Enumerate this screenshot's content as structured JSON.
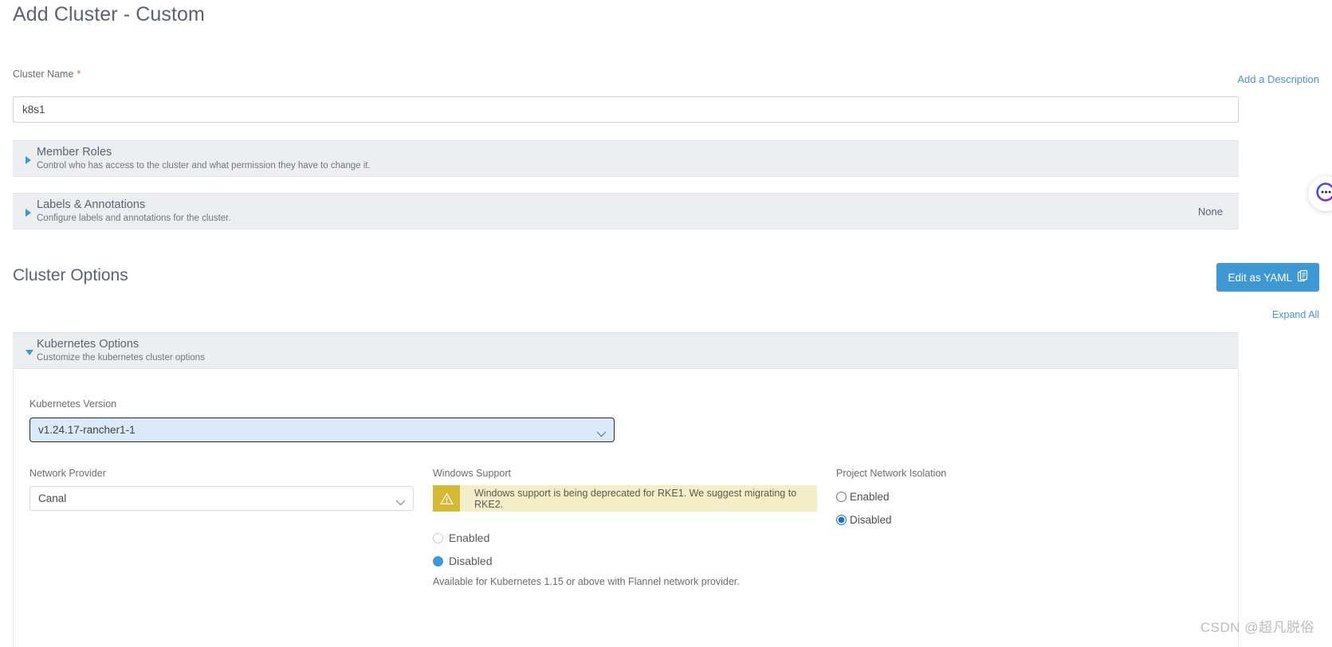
{
  "page": {
    "title": "Add Cluster - Custom",
    "watermark": "CSDN @超凡脱俗"
  },
  "cluster_name": {
    "label": "Cluster Name",
    "required_marker": "*",
    "value": "k8s1",
    "placeholder": "",
    "add_description_link": "Add a Description"
  },
  "accordions": [
    {
      "name": "member-roles",
      "title": "Member Roles",
      "subtitle": "Control who has access to the cluster and what permission they have to change it.",
      "expanded": false,
      "right_value": ""
    },
    {
      "name": "labels-annotations",
      "title": "Labels & Annotations",
      "subtitle": "Configure labels and annotations for the cluster.",
      "expanded": false,
      "right_value": "None"
    }
  ],
  "cluster_options": {
    "heading": "Cluster Options",
    "edit_as_yaml_label": "Edit as YAML",
    "edit_as_yaml_icon": "clipboard-icon",
    "expand_all_label": "Expand All",
    "kubernetes_options": {
      "title": "Kubernetes Options",
      "subtitle": "Customize the kubernetes cluster options",
      "expanded": true
    },
    "kubernetes_version": {
      "label": "Kubernetes Version",
      "value": "v1.24.17-rancher1-1",
      "focused": true
    },
    "network_provider": {
      "label": "Network Provider",
      "value": "Canal"
    },
    "windows_support": {
      "label": "Windows Support",
      "warning_text": "Windows support is being deprecated for RKE1. We suggest migrating to RKE2.",
      "warning_icon": "warning-triangle-icon",
      "options": [
        {
          "label": "Enabled",
          "selected": false
        },
        {
          "label": "Disabled",
          "selected": true
        }
      ],
      "helper_text": "Available for Kubernetes 1.15 or above with Flannel network provider."
    },
    "project_network_isolation": {
      "label": "Project Network Isolation",
      "options": [
        {
          "label": "Enabled",
          "selected": false
        },
        {
          "label": "Disabled",
          "selected": true
        }
      ]
    }
  },
  "chat_widget": {
    "icon": "chat-bubble-icon"
  },
  "colors": {
    "accent_blue": "#3d98d3",
    "link_blue": "#4a93d0",
    "banner_grey": "#eceef1",
    "warning_bg": "#f3eec8",
    "warning_icon_bg": "#d4b933",
    "focus_fill": "#dbeafa",
    "required_red": "#e1604f"
  }
}
